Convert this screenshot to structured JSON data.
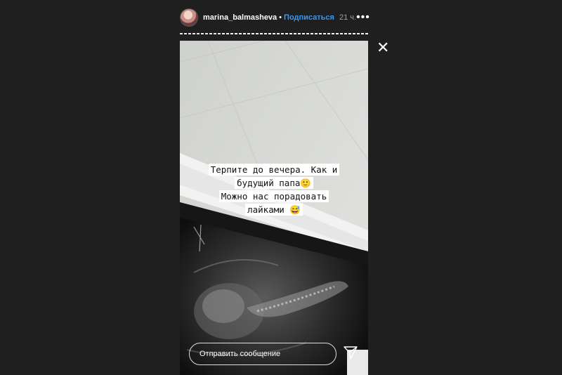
{
  "header": {
    "username": "marina_balmasheva",
    "separator": "•",
    "follow_label": "Подписаться",
    "time": "21 ч.",
    "more_glyph": "•••"
  },
  "story": {
    "caption_lines": [
      "Терпите до вечера. Как и",
      "будущий папа🙂",
      "Можно нас порадовать",
      "лайками 😅"
    ],
    "reply_placeholder": "Отправить сообщение"
  },
  "icons": {
    "close": "close-icon",
    "more": "more-options-icon",
    "send": "send-direct-icon",
    "avatar": "avatar"
  },
  "colors": {
    "background": "#1f1f1f",
    "follow": "#3897f0",
    "time": "#9e9e9e",
    "text": "#ffffff"
  }
}
